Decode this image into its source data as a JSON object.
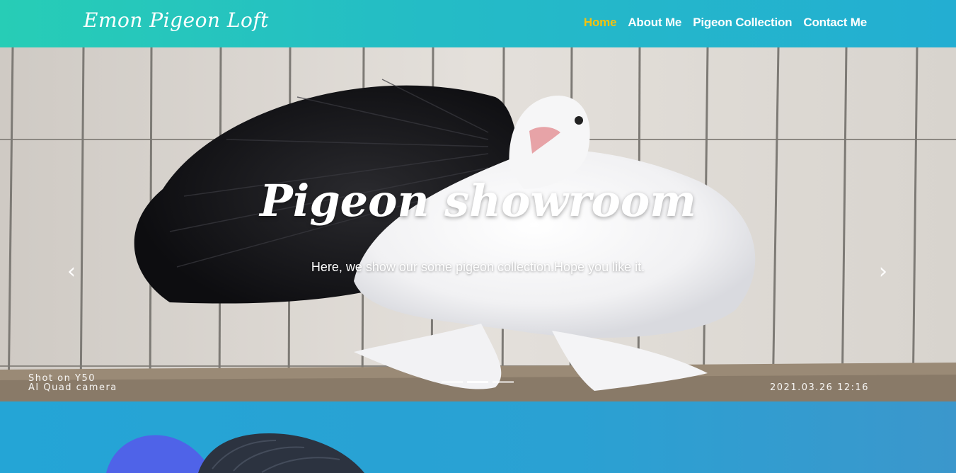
{
  "nav": {
    "brand": "Emon Pigeon Loft",
    "links": [
      {
        "label": "Home",
        "active": true
      },
      {
        "label": "About Me",
        "active": false
      },
      {
        "label": "Pigeon Collection",
        "active": false
      },
      {
        "label": "Contact Me",
        "active": false
      }
    ],
    "active_color": "#f4c20d"
  },
  "hero": {
    "title": "Pigeon showroom",
    "subtitle": "Here, we show our some pigeon collection.Hope you like it.",
    "prev_icon": "chevron-left-icon",
    "next_icon": "chevron-right-icon",
    "slide_count": 3,
    "active_slide": 2,
    "camera_line1": "Shot on Y50",
    "camera_line2": "AI Quad camera",
    "timestamp": "2021.03.26 12:16"
  },
  "colors": {
    "nav_gradient_start": "#27cdb6",
    "nav_gradient_end": "#23aed2",
    "section_blue": "#24a5d6"
  }
}
